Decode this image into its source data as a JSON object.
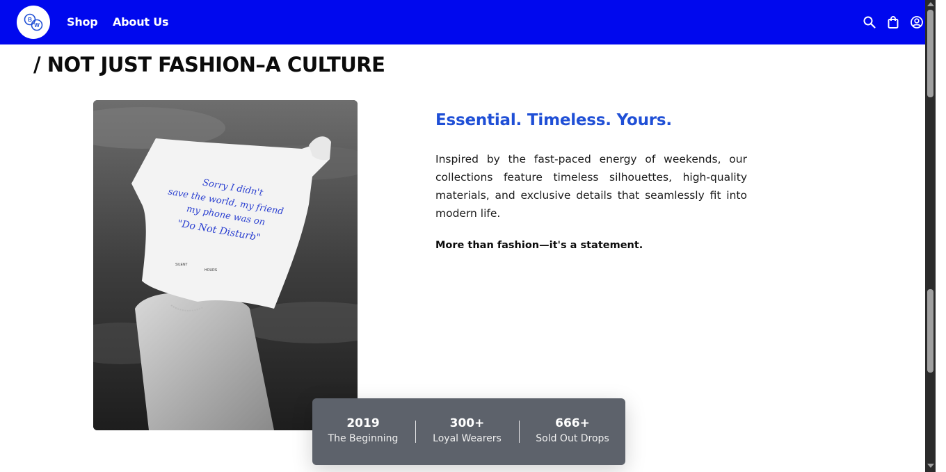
{
  "nav": {
    "logo_text": "BW",
    "links": [
      "Shop",
      "About Us"
    ],
    "icons": [
      "search-icon",
      "shopping-bag-icon",
      "user-icon"
    ],
    "brand_color": "#0008ee"
  },
  "section": {
    "title": "/ NOT JUST FASHION–A CULTURE"
  },
  "photo": {
    "shirt_text": [
      "Sorry I didn't",
      "save the world, my friend",
      "my phone was on",
      "\"Do Not Disturb\""
    ],
    "tag_left": "SILENT",
    "tag_right": "HOURS"
  },
  "content": {
    "subheading": "Essential. Timeless. Yours.",
    "subheading_color": "#1f4fd6",
    "paragraph": "Inspired by the fast-paced energy of weekends, our collections feature timeless silhouettes, high-quality materials, and exclusive details that seamlessly fit into modern life.",
    "statement": "More than fashion—it's a statement."
  },
  "stats": [
    {
      "value": "2019",
      "label": "The Beginning"
    },
    {
      "value": "300+",
      "label": "Loyal Wearers"
    },
    {
      "value": "666+",
      "label": "Sold Out Drops"
    }
  ]
}
